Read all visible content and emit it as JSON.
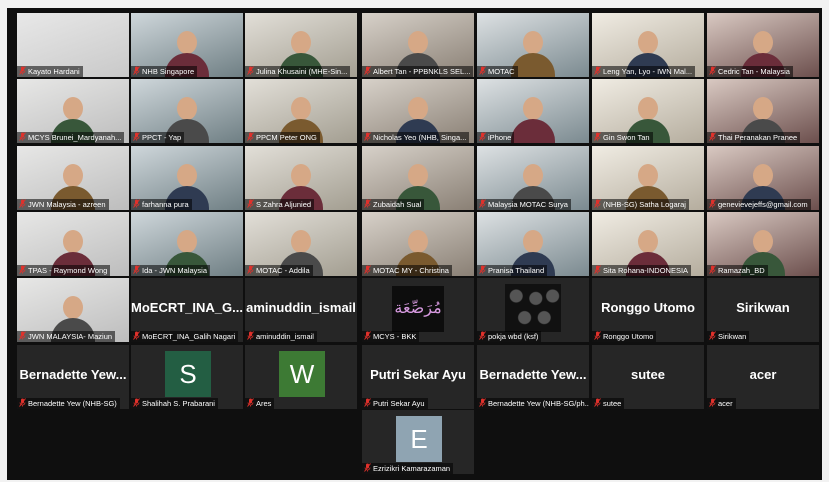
{
  "meeting": {
    "tiles": [
      {
        "name": "Kayato Hardani",
        "kind": "blank-icon"
      },
      {
        "name": "NHB Singapore",
        "kind": "video",
        "active": true
      },
      {
        "name": "Julina Khusaini (MHE-Sin...",
        "kind": "video"
      },
      {
        "name": "Albert Tan - PPBNKLS SEL...",
        "kind": "video"
      },
      {
        "name": "MOTAC",
        "kind": "video"
      },
      {
        "name": "Leng Yan, Lyo - IWN Mal...",
        "kind": "video"
      },
      {
        "name": "Cedric Tan - Malaysia",
        "kind": "video"
      },
      {
        "name": "MCYS Brunei_Mardyanah...",
        "kind": "video"
      },
      {
        "name": "PPCT - Yap",
        "kind": "video"
      },
      {
        "name": "PPCM Peter ONG",
        "kind": "video"
      },
      {
        "name": "Nicholas Yeo (NHB, Singa...",
        "kind": "video"
      },
      {
        "name": "iPhone",
        "kind": "video"
      },
      {
        "name": "Gin Swon Tan",
        "kind": "video"
      },
      {
        "name": "Thai Peranakan Pranee",
        "kind": "video"
      },
      {
        "name": "JWN Malaysia - azreen",
        "kind": "video"
      },
      {
        "name": "farhanna pura",
        "kind": "video"
      },
      {
        "name": "S Zahra Aljunied",
        "kind": "video"
      },
      {
        "name": "Zubaidah Sual",
        "kind": "video"
      },
      {
        "name": "Malaysia MOTAC Surya",
        "kind": "video"
      },
      {
        "name": "(NHB-SG) Satha Logaraj",
        "kind": "video"
      },
      {
        "name": "genevievejeffs@gmail.com",
        "kind": "video"
      },
      {
        "name": "TPAS - Raymond Wong",
        "kind": "video"
      },
      {
        "name": "Ida - JWN Malaysia",
        "kind": "video"
      },
      {
        "name": "MOTAC - Addila",
        "kind": "video"
      },
      {
        "name": "MOTAC MY - Christina",
        "kind": "video"
      },
      {
        "name": "Pranisa Thailand",
        "kind": "video"
      },
      {
        "name": "Sita Rohana-INDONESIA",
        "kind": "video"
      },
      {
        "name": "Ramazah_BD",
        "kind": "video"
      },
      {
        "name": "JWN MALAYSIA- Maziun",
        "kind": "video"
      },
      {
        "name": "MoECRT_INA_Galih Nagari",
        "kind": "bigname",
        "big": "MoECRT_INA_G..."
      },
      {
        "name": "aminuddin_ismail",
        "kind": "bigname",
        "big": "aminuddin_ismail"
      },
      {
        "name": "MCYS - BKK",
        "kind": "art"
      },
      {
        "name": "pokja wbd (ksf)",
        "kind": "pattern"
      },
      {
        "name": "Ronggo Utomo",
        "kind": "bigname",
        "big": "Ronggo Utomo"
      },
      {
        "name": "Sirikwan",
        "kind": "bigname",
        "big": "Sirikwan"
      },
      {
        "name": "Bernadette Yew (NHB-SG)",
        "kind": "bigname",
        "big": "Bernadette Yew..."
      },
      {
        "name": "Shalihah S. Prabarani",
        "kind": "letter",
        "letter": "S",
        "color": "#235e43"
      },
      {
        "name": "Ares",
        "kind": "letter",
        "letter": "W",
        "color": "#3d7a34"
      },
      {
        "name": "Putri Sekar Ayu",
        "kind": "bigname",
        "big": "Putri Sekar Ayu"
      },
      {
        "name": "Bernadette Yew (NHB-SG/ph...",
        "kind": "bigname",
        "big": "Bernadette Yew..."
      },
      {
        "name": "sutee",
        "kind": "bigname",
        "big": "sutee"
      },
      {
        "name": "acer",
        "kind": "bigname",
        "big": "acer"
      },
      {
        "name": "Ezrizikri Kamarazaman",
        "kind": "letter",
        "letter": "E",
        "color": "#8fa4b2"
      }
    ]
  },
  "colors": {
    "background": "#0f0f0f",
    "tile": "#262626",
    "active_border": "#d9c43a",
    "muted_mic": "#e0312b"
  },
  "icons": {
    "muted": "microphone-muted-icon"
  },
  "art_text": "مُرَصِّعَة"
}
